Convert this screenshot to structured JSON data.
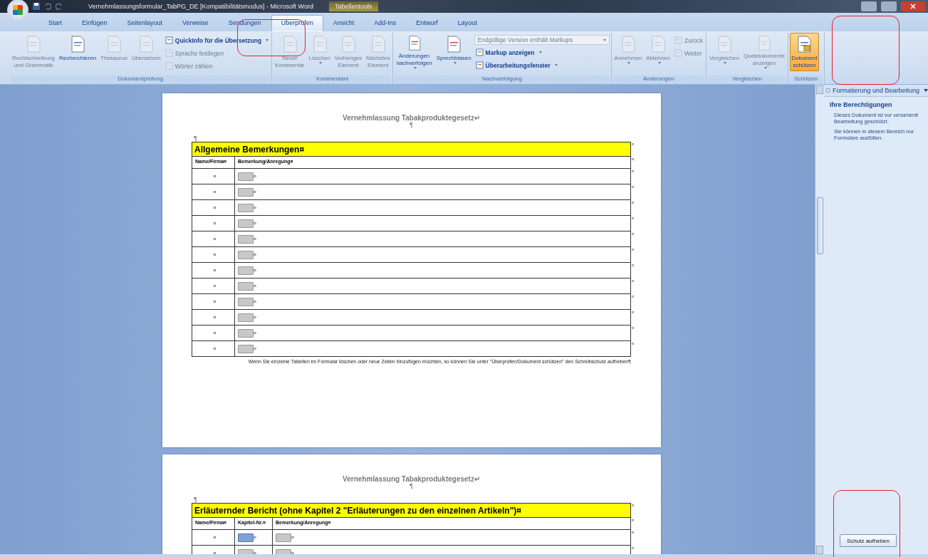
{
  "title_bar": {
    "title": "Vernehmlassungsformular_TabPG_DE [Kompatibilitätsmodus] - Microsoft Word",
    "contextual_tab": "Tabellentools"
  },
  "tabs": [
    {
      "label": "Start",
      "selected": false
    },
    {
      "label": "Einfügen",
      "selected": false
    },
    {
      "label": "Seitenlayout",
      "selected": false
    },
    {
      "label": "Verweise",
      "selected": false
    },
    {
      "label": "Sendungen",
      "selected": false
    },
    {
      "label": "Überprüfen",
      "selected": true
    },
    {
      "label": "Ansicht",
      "selected": false
    },
    {
      "label": "Add-Ins",
      "selected": false
    },
    {
      "label": "Entwurf",
      "selected": false
    },
    {
      "label": "Layout",
      "selected": false
    }
  ],
  "ribbon": {
    "groups": [
      {
        "label": "Dokumentprüfung",
        "columns": [
          {
            "kind": "large",
            "lines": [
              "Rechtschreibung",
              "und Grammatik"
            ],
            "disabled": true,
            "selected": false,
            "has_menu": false
          },
          {
            "kind": "large",
            "lines": [
              "Recherchieren"
            ],
            "disabled": false,
            "selected": false,
            "has_menu": false
          },
          {
            "kind": "large",
            "lines": [
              "Thesaurus"
            ],
            "disabled": true,
            "selected": false,
            "has_menu": false
          },
          {
            "kind": "large",
            "lines": [
              "Übersetzen"
            ],
            "disabled": true,
            "selected": false,
            "has_menu": false
          },
          {
            "kind": "stack",
            "items": [
              {
                "kind": "small",
                "label": "QuickInfo für die Übersetzung",
                "disabled": false,
                "has_menu": true
              },
              {
                "kind": "small",
                "label": "Sprache festlegen",
                "disabled": true,
                "has_menu": false
              },
              {
                "kind": "small",
                "label": "Wörter zählen",
                "disabled": true,
                "has_menu": false
              }
            ]
          }
        ]
      },
      {
        "label": "Kommentare",
        "columns": [
          {
            "kind": "large",
            "lines": [
              "Neuer",
              "Kommentar"
            ],
            "disabled": true,
            "selected": false,
            "has_menu": false
          },
          {
            "kind": "large",
            "lines": [
              "Löschen"
            ],
            "disabled": true,
            "selected": false,
            "has_menu": true
          },
          {
            "kind": "large",
            "lines": [
              "Vorheriges",
              "Element"
            ],
            "disabled": true,
            "selected": false,
            "has_menu": false
          },
          {
            "kind": "large",
            "lines": [
              "Nächstes",
              "Element"
            ],
            "disabled": true,
            "selected": false,
            "has_menu": false
          }
        ]
      },
      {
        "label": "Nachverfolgung",
        "columns": [
          {
            "kind": "large",
            "lines": [
              "Änderungen",
              "nachverfolgen"
            ],
            "disabled": false,
            "selected": false,
            "has_menu": true
          },
          {
            "kind": "large",
            "lines": [
              "Sprechblasen"
            ],
            "disabled": false,
            "selected": false,
            "has_menu": true
          },
          {
            "kind": "stack",
            "items": [
              {
                "kind": "dropdown",
                "label": "Endgültige Version enthält Markups",
                "disabled": true,
                "has_menu": true
              },
              {
                "kind": "small",
                "label": "Markup anzeigen",
                "disabled": false,
                "has_menu": true
              },
              {
                "kind": "small",
                "label": "Überarbeitungsfenster",
                "disabled": false,
                "has_menu": true
              }
            ]
          }
        ]
      },
      {
        "label": "Änderungen",
        "columns": [
          {
            "kind": "large",
            "lines": [
              "Annehmen"
            ],
            "disabled": true,
            "selected": false,
            "has_menu": true
          },
          {
            "kind": "large",
            "lines": [
              "Ablehnen"
            ],
            "disabled": true,
            "selected": false,
            "has_menu": true
          },
          {
            "kind": "stack",
            "items": [
              {
                "kind": "small",
                "label": "Zurück",
                "disabled": true,
                "has_menu": false
              },
              {
                "kind": "small",
                "label": "Weiter",
                "disabled": true,
                "has_menu": false
              }
            ]
          }
        ]
      },
      {
        "label": "Vergleichen",
        "columns": [
          {
            "kind": "large",
            "lines": [
              "Vergleichen"
            ],
            "disabled": true,
            "selected": false,
            "has_menu": true
          },
          {
            "kind": "large",
            "lines": [
              "Quelldokumente",
              "anzeigen"
            ],
            "disabled": true,
            "selected": false,
            "has_menu": true
          }
        ]
      },
      {
        "label": "Schützen",
        "columns": [
          {
            "kind": "large",
            "lines": [
              "Dokument",
              "schützen"
            ],
            "disabled": false,
            "selected": true,
            "has_menu": false
          }
        ]
      }
    ]
  },
  "pages": [
    {
      "header": "Vernehmlassung Tabakproduktegesetz↵",
      "header_mark": "¶",
      "para_mark": "¶",
      "table": {
        "title": "Allgemeine Bemerkungen¤",
        "title_end": "¤",
        "columns": [
          {
            "label": "Name/Firma¤"
          },
          {
            "label": "Bemerkung/Anregung¤"
          }
        ],
        "header_end": "¤",
        "rows": [
          {
            "cells": [
              {
                "kind": "text",
                "text": "¤"
              },
              {
                "kind": "field",
                "mark": "¤",
                "selected": false
              }
            ],
            "end_mark": "¤"
          },
          {
            "cells": [
              {
                "kind": "text",
                "text": "¤"
              },
              {
                "kind": "field",
                "mark": "¤",
                "selected": false
              }
            ],
            "end_mark": "¤"
          },
          {
            "cells": [
              {
                "kind": "text",
                "text": "¤"
              },
              {
                "kind": "field",
                "mark": "¤",
                "selected": false
              }
            ],
            "end_mark": "¤"
          },
          {
            "cells": [
              {
                "kind": "text",
                "text": "¤"
              },
              {
                "kind": "field",
                "mark": "¤",
                "selected": false
              }
            ],
            "end_mark": "¤"
          },
          {
            "cells": [
              {
                "kind": "text",
                "text": "¤"
              },
              {
                "kind": "field",
                "mark": "¤",
                "selected": false
              }
            ],
            "end_mark": "¤"
          },
          {
            "cells": [
              {
                "kind": "text",
                "text": "¤"
              },
              {
                "kind": "field",
                "mark": "¤",
                "selected": false
              }
            ],
            "end_mark": "¤"
          },
          {
            "cells": [
              {
                "kind": "text",
                "text": "¤"
              },
              {
                "kind": "field",
                "mark": "¤",
                "selected": false
              }
            ],
            "end_mark": "¤"
          },
          {
            "cells": [
              {
                "kind": "text",
                "text": "¤"
              },
              {
                "kind": "field",
                "mark": "¤",
                "selected": false
              }
            ],
            "end_mark": "¤"
          },
          {
            "cells": [
              {
                "kind": "text",
                "text": "¤"
              },
              {
                "kind": "field",
                "mark": "¤",
                "selected": false
              }
            ],
            "end_mark": "¤"
          },
          {
            "cells": [
              {
                "kind": "text",
                "text": "¤"
              },
              {
                "kind": "field",
                "mark": "¤",
                "selected": false
              }
            ],
            "end_mark": "¤"
          },
          {
            "cells": [
              {
                "kind": "text",
                "text": "¤"
              },
              {
                "kind": "field",
                "mark": "¤",
                "selected": false
              }
            ],
            "end_mark": "¤"
          },
          {
            "cells": [
              {
                "kind": "text",
                "text": "¤"
              },
              {
                "kind": "field",
                "mark": "¤",
                "selected": false
              }
            ],
            "end_mark": "¤"
          }
        ]
      },
      "note": "Wenn Sie einzelne Tabellen im Formular löschen oder neue Zeilen hinzufügen möchten, so können Sie unter \"Überprüfen/Dokument schützen\" den Schreibschutz aufheben¶"
    },
    {
      "header": "Vernehmlassung Tabakproduktegesetz↵",
      "header_mark": "¶",
      "para_mark": "¶",
      "table": {
        "title": "Erläuternder Bericht (ohne Kapitel 2 \"Erläuterungen zu den einzelnen Artikeln\")¤",
        "title_end": "¤",
        "columns": [
          {
            "label": "Name/Firma¤"
          },
          {
            "label": "Kapitel-Nr.¤"
          },
          {
            "label": "Bemerkung/Anregung¤"
          }
        ],
        "header_end": "¤",
        "rows": [
          {
            "cells": [
              {
                "kind": "text",
                "text": "¤"
              },
              {
                "kind": "field",
                "mark": "¤",
                "selected": true
              },
              {
                "kind": "field",
                "mark": "¤",
                "selected": false
              }
            ],
            "end_mark": "¤"
          },
          {
            "cells": [
              {
                "kind": "text",
                "text": "¤"
              },
              {
                "kind": "field",
                "mark": "¤",
                "selected": false
              },
              {
                "kind": "field",
                "mark": "¤",
                "selected": false
              }
            ],
            "end_mark": "¤"
          }
        ]
      }
    }
  ],
  "task_pane": {
    "title": "Formatierung und Bearbeitung",
    "heading": "Ihre Berechtigungen",
    "lines": [
      "Dieses Dokument ist vor versehentl",
      "Bearbeitung geschützt."
    ],
    "text2": "Sie können in diesem Bereich nur Formulare ausfüllen.",
    "button": "Schutz aufheben"
  }
}
